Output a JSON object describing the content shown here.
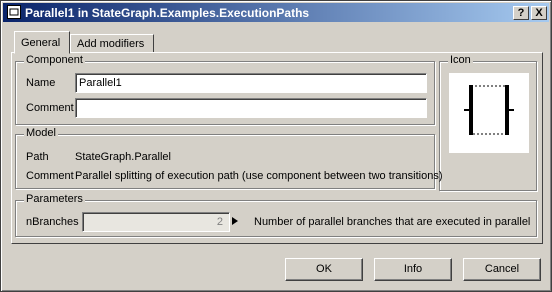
{
  "window": {
    "title": "Parallel1 in StateGraph.Examples.ExecutionPaths",
    "help_label": "?",
    "close_label": "X"
  },
  "tabs": [
    {
      "label": "General"
    },
    {
      "label": "Add modifiers"
    }
  ],
  "component": {
    "legend": "Component",
    "name_label": "Name",
    "name_value": "Parallel1",
    "comment_label": "Comment",
    "comment_value": ""
  },
  "icon": {
    "legend": "Icon",
    "name": "parallel-block-icon"
  },
  "model": {
    "legend": "Model",
    "path_label": "Path",
    "path_value": "StateGraph.Parallel",
    "comment_label": "Comment",
    "comment_value": "Parallel splitting of execution path (use component between two transitions)"
  },
  "parameters": {
    "legend": "Parameters",
    "nbranches_label": "nBranches",
    "nbranches_value": "2",
    "nbranches_description": "Number of parallel branches that are executed in parallel",
    "arrow_icon": "triangle-right-icon"
  },
  "buttons": {
    "ok": "OK",
    "info": "Info",
    "cancel": "Cancel"
  }
}
